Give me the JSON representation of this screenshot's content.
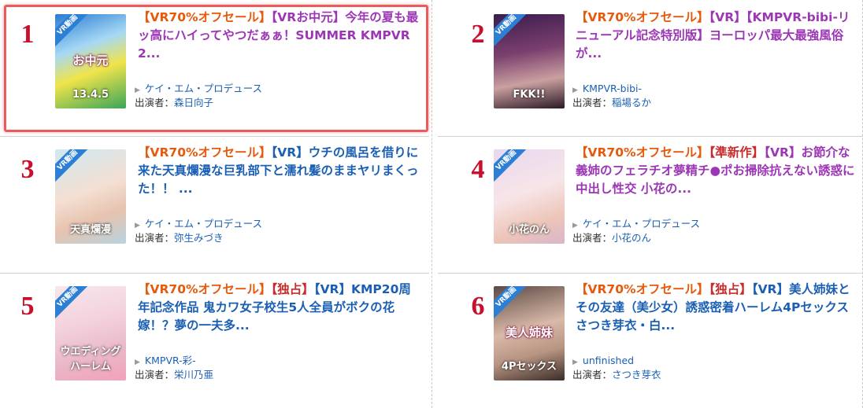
{
  "items": [
    {
      "rank": "1",
      "sale": "【VR70%オフセール】",
      "special": "",
      "rest": "【VRお中元】今年の夏も最ッ高にハイってやつだぁぁ！SUMMER KMPVR 2...",
      "maker": "ケイ・エム・プロデュース",
      "cast_label": "出演者：",
      "cast": "森日向子",
      "color": "purple",
      "thumb": {
        "bg": "linear-gradient(160deg,#2a7bd1 0%,#a6d8f5 35%,#f0e44a 60%,#3aa55a 100%)",
        "text": "13.4.5",
        "label": "お中元"
      }
    },
    {
      "rank": "2",
      "sale": "【VR70%オフセール】",
      "special": "",
      "rest": "【VR】【KMPVR-bibi-リニューアル記念特別版】ヨーロッパ最大最強風俗が...",
      "maker": "KMPVR-bibi-",
      "cast_label": "出演者：",
      "cast": "稲場るか",
      "color": "purple",
      "thumb": {
        "bg": "linear-gradient(170deg,#3b1c4e 0%,#7a3f6e 40%,#caa0a0 70%,#2b1a26 100%)",
        "text": "FKK!!",
        "label": ""
      }
    },
    {
      "rank": "3",
      "sale": "【VR70%オフセール】",
      "special": "",
      "rest": "【VR】ウチの風呂を借りに来た天真爛漫な巨乳部下と濡れ髪のままヤリまくった！！ ...",
      "maker": "ケイ・エム・プロデュース",
      "cast_label": "出演者：",
      "cast": "弥生みづき",
      "color": "blue",
      "thumb": {
        "bg": "linear-gradient(160deg,#cfe8f2 0%,#f4dfd2 45%,#e7c3b0 70%,#b8d3de 100%)",
        "text": "天真爛漫",
        "label": ""
      }
    },
    {
      "rank": "4",
      "sale": "【VR70%オフセール】",
      "special": "【準新作】",
      "rest": "【VR】お節介な義姉のフェラチオ夢精チ●ポお掃除抗えない誘惑に中出し性交 小花の...",
      "maker": "ケイ・エム・プロデュース",
      "cast_label": "出演者：",
      "cast": "小花のん",
      "color": "purple",
      "thumb": {
        "bg": "linear-gradient(160deg,#e8d8ef 0%,#f7e5e8 45%,#edc6b9 75%,#d8b6c8 100%)",
        "text": "小花のん",
        "label": ""
      }
    },
    {
      "rank": "5",
      "sale": "【VR70%オフセール】",
      "special": "【独占】",
      "rest": "【VR】KMP20周年記念作品 鬼カワ女子校生5人全員がボクの花嫁！？夢の一夫多...",
      "maker": "KMPVR-彩-",
      "cast_label": "出演者：",
      "cast": "栄川乃亜",
      "color": "blue",
      "thumb": {
        "bg": "linear-gradient(165deg,#f7e6ee 0%,#f3d1dc 40%,#e9b9c9 70%,#f2a1b8 100%)",
        "text": "ウエディングハーレム",
        "label": ""
      }
    },
    {
      "rank": "6",
      "sale": "【VR70%オフセール】",
      "special": "【独占】",
      "rest": "【VR】美人姉妹とその友達（美少女）誘惑密着ハーレム4Pセックス さつき芽衣・白...",
      "maker": "unfinished",
      "cast_label": "出演者：",
      "cast": "さつき芽衣",
      "color": "blue",
      "thumb": {
        "bg": "linear-gradient(165deg,#5c4a44 0%,#d9b9a8 45%,#b89482 70%,#3a2c28 100%)",
        "text": "4Pセックス",
        "label": "美人姉妹"
      }
    }
  ]
}
